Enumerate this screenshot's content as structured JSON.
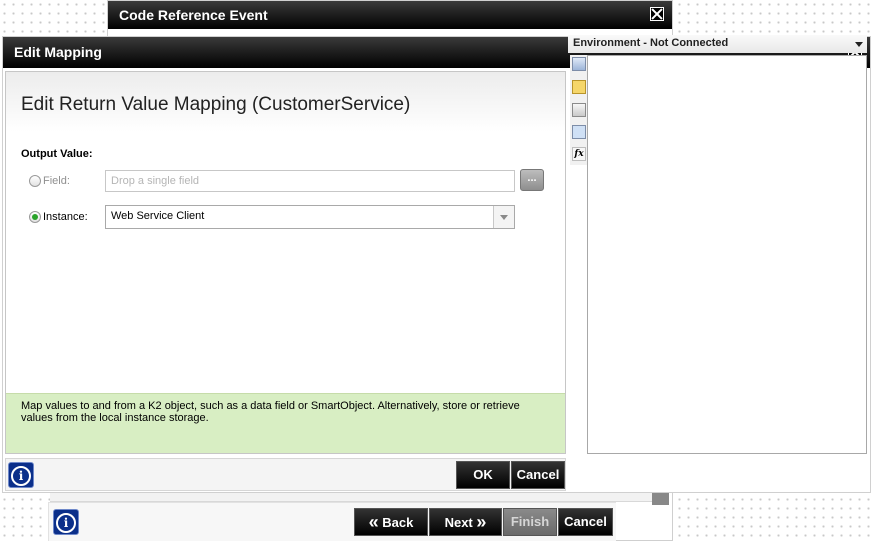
{
  "background_window": {
    "title": "Code Reference Event",
    "wizard_buttons": {
      "back": "Back",
      "next": "Next",
      "finish": "Finish",
      "cancel": "Cancel"
    }
  },
  "dialog": {
    "title": "Edit Mapping",
    "heading": "Edit Return Value Mapping (CustomerService)",
    "output_value_label": "Output Value:",
    "field": {
      "label": "Field:",
      "placeholder": "Drop a single field",
      "browse_label": "...",
      "selected": false
    },
    "instance": {
      "label": "Instance:",
      "value": "Web Service Client",
      "selected": true
    },
    "help_text": "Map values to and from a K2 object, such as a data field or SmartObject. Alternatively, store or retrieve values from the local instance storage.",
    "buttons": {
      "ok": "OK",
      "cancel": "Cancel"
    }
  },
  "environment": {
    "label": "Environment - Not Connected",
    "tools": [
      "environment-icon",
      "datafield-icon",
      "smartobject-icon",
      "instance-icon",
      "function-icon"
    ],
    "function_glyph": "fx"
  },
  "colors": {
    "title_bar": "#000000",
    "help_background": "#d8eec3",
    "info_button": "#0b2f8a",
    "radio_checked": "#2aa32a"
  }
}
